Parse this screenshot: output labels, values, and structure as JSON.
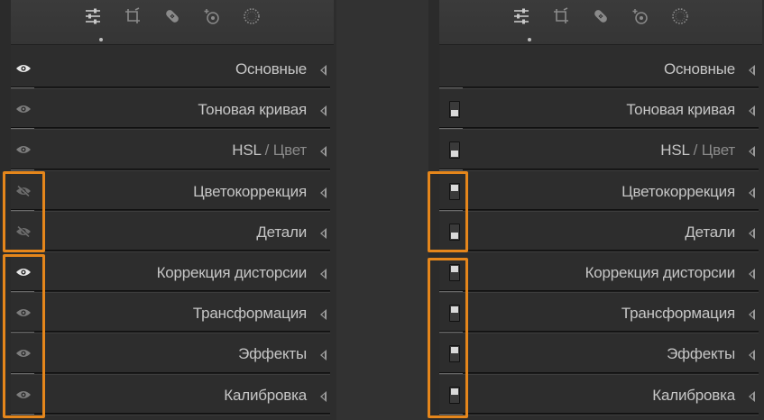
{
  "toolbar": {
    "tools": [
      {
        "name": "sliders-icon",
        "active": true
      },
      {
        "name": "crop-icon",
        "active": false
      },
      {
        "name": "healing-brush-icon",
        "active": false
      },
      {
        "name": "red-eye-icon",
        "active": false
      },
      {
        "name": "radial-filter-icon",
        "active": false
      }
    ]
  },
  "panels": [
    {
      "id": "left",
      "control": "eye",
      "sections": [
        {
          "title": "Основные",
          "state": "visible-bright"
        },
        {
          "title": "Тоновая кривая",
          "state": "visible"
        },
        {
          "title_main": "HSL",
          "title_sep": " / ",
          "title_dim": "Цвет",
          "state": "visible"
        },
        {
          "title": "Цветокоррекция",
          "state": "hidden"
        },
        {
          "title": "Детали",
          "state": "hidden"
        },
        {
          "title": "Коррекция дисторсии",
          "state": "visible-bright"
        },
        {
          "title": "Трансформация",
          "state": "visible"
        },
        {
          "title": "Эффекты",
          "state": "visible"
        },
        {
          "title": "Калибровка",
          "state": "visible"
        }
      ]
    },
    {
      "id": "right",
      "control": "switch",
      "sections": [
        {
          "title": "Основные",
          "state": "none"
        },
        {
          "title": "Тоновая кривая",
          "state": "on"
        },
        {
          "title_main": "HSL",
          "title_sep": " / ",
          "title_dim": "Цвет",
          "state": "on"
        },
        {
          "title": "Цветокоррекция",
          "state": "off"
        },
        {
          "title": "Детали",
          "state": "on"
        },
        {
          "title": "Коррекция дисторсии",
          "state": "off"
        },
        {
          "title": "Трансформация",
          "state": "off"
        },
        {
          "title": "Эффекты",
          "state": "off"
        },
        {
          "title": "Калибровка",
          "state": "off"
        }
      ]
    }
  ],
  "colors": {
    "highlight": "#e5861b",
    "text": "#c6c6c6",
    "panel": "#2d2d2d"
  }
}
